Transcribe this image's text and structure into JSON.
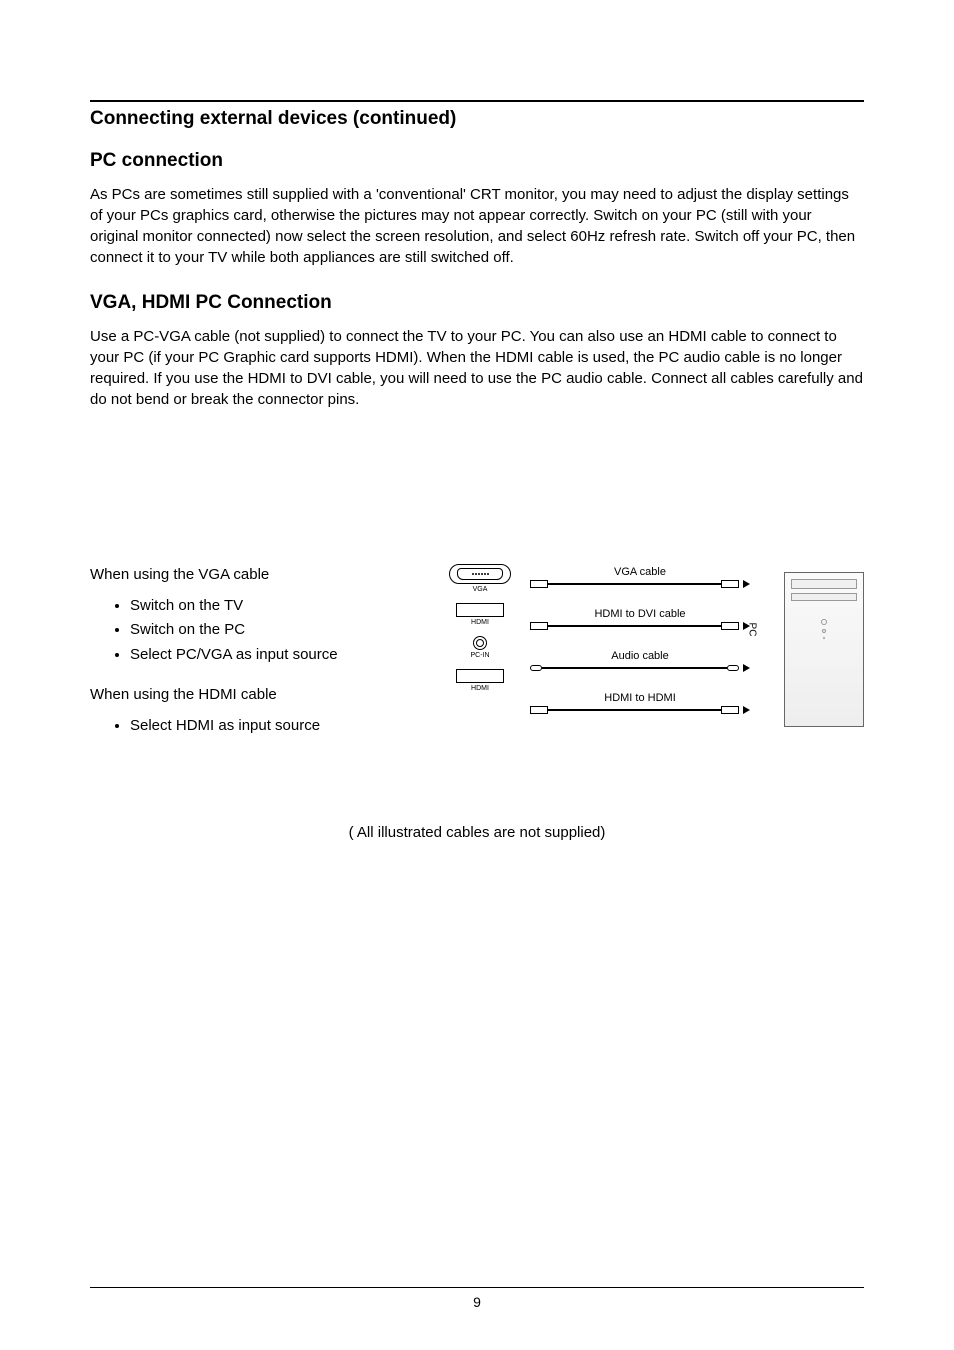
{
  "header": {
    "title": "Connecting external devices (continued)"
  },
  "section1": {
    "heading": "PC connection",
    "body": "As PCs are sometimes still supplied with a 'conventional' CRT monitor, you may need to adjust the display settings of your PCs graphics card, otherwise the pictures may not appear correctly. Switch on your PC (still with your original monitor connected) now select the screen resolution, and select 60Hz refresh rate. Switch off your PC, then connect it to your TV while both appliances are still switched off."
  },
  "section2": {
    "heading": "VGA, HDMI PC Connection",
    "body": "Use a PC-VGA cable (not supplied) to connect the TV to your PC. You can also use an HDMI cable to connect to your PC (if your PC Graphic card supports HDMI). When the HDMI cable is used, the PC audio cable is no longer required. If you use the HDMI to DVI cable, you will need to use the PC audio cable. Connect all cables carefully and do not bend or break the connector pins."
  },
  "instructions": {
    "vga_lead": "When using the VGA cable",
    "vga_items": [
      "Switch on the TV",
      "Switch on the PC",
      "Select PC/VGA as input source"
    ],
    "hdmi_lead": "When using the HDMI cable",
    "hdmi_items": [
      "Select HDMI as input source"
    ]
  },
  "diagram": {
    "ports": {
      "vga": "VGA",
      "hdmi1": "HDMI",
      "pcin": "PC-IN",
      "hdmi2": "HDMI"
    },
    "cables": {
      "vga": "VGA cable",
      "hdmi_dvi": "HDMI to DVI cable",
      "audio": "Audio cable",
      "hdmi_hdmi": "HDMI to HDMI"
    },
    "pc_label": "PC"
  },
  "footnote": "( All illustrated cables are not supplied)",
  "page_number": "9"
}
